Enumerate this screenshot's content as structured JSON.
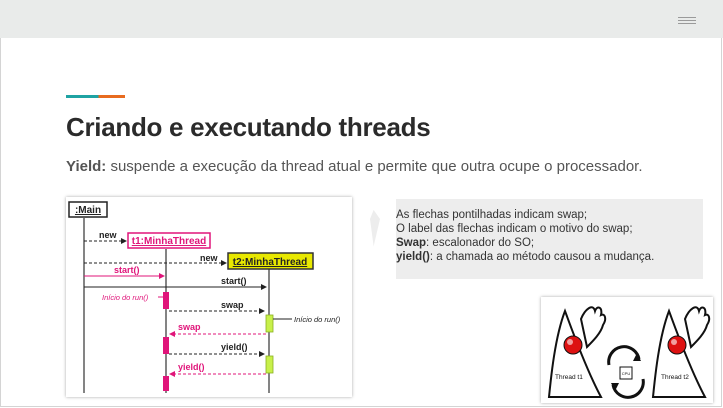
{
  "slide": {
    "title": "Criando e executando threads",
    "subtitle_term": "Yield:",
    "subtitle_text": " suspende a execução  da thread atual e permite que outra ocupe o processador."
  },
  "diagram": {
    "main_label": ":Main",
    "t1_label": "t1:MinhaThread",
    "t2_label": "t2:MinhaThread",
    "msg_new1": "new",
    "msg_new2": "new",
    "msg_start1": "start()",
    "msg_start2": "start()",
    "note_inicio1": "Início do run()",
    "msg_swap1": "swap",
    "note_inicio2": "Início do run()",
    "msg_swap2": "swap",
    "msg_yield1": "yield()",
    "msg_yield2": "yield()"
  },
  "note": {
    "line1": "As flechas pontilhadas indicam swap;",
    "line2": "O label das flechas indicam o motivo do swap;",
    "line3_term": "Swap",
    "line3_text": ": escalonador do SO;",
    "line4_term": "yield()",
    "line4_text": ": a chamada ao método causou a mudança."
  },
  "illustration": {
    "thread1": "Thread t1",
    "thread2": "Thread t2",
    "cpu": "CPU"
  },
  "colors": {
    "accent_teal": "#1fa3a3",
    "accent_orange": "#e86b1f",
    "magenta": "#e0157a",
    "lime": "#c8f04a",
    "yellow": "#e8e800"
  }
}
